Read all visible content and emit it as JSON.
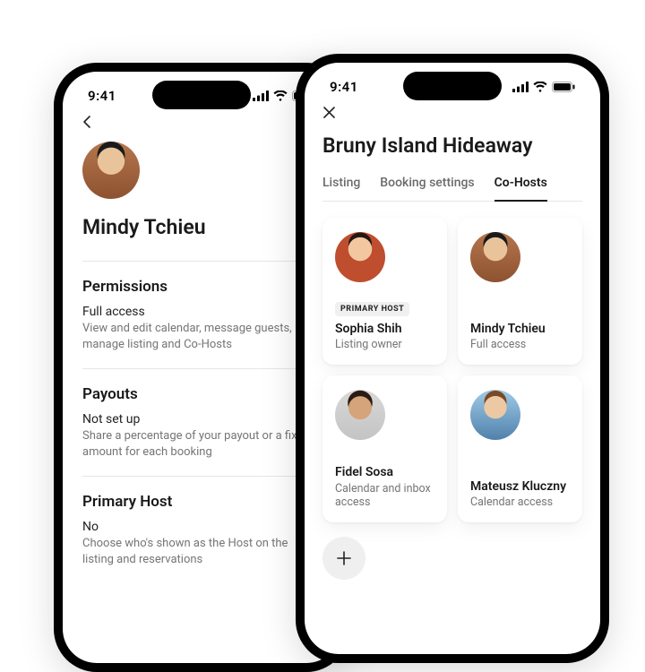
{
  "status": {
    "time": "9:41"
  },
  "back": {
    "name": "Mindy Tchieu",
    "sections": [
      {
        "title": "Permissions",
        "value": "Full access",
        "desc": "View and edit calendar, message guests, manage listing and Co-Hosts"
      },
      {
        "title": "Payouts",
        "value": "Not set up",
        "desc": "Share a percentage of your payout or a fixed amount for each booking"
      },
      {
        "title": "Primary Host",
        "value": "No",
        "desc": "Choose who's shown as the Host on the listing and reservations"
      }
    ]
  },
  "front": {
    "title": "Bruny Island Hideaway",
    "tabs": [
      {
        "label": "Listing",
        "active": false
      },
      {
        "label": "Booking settings",
        "active": false
      },
      {
        "label": "Co-Hosts",
        "active": true
      }
    ],
    "hosts": [
      {
        "name": "Sophia Shih",
        "role": "Listing owner",
        "badge": "PRIMARY HOST",
        "face": "f1"
      },
      {
        "name": "Mindy Tchieu",
        "role": "Full access",
        "badge": null,
        "face": "f2"
      },
      {
        "name": "Fidel Sosa",
        "role": "Calendar and inbox access",
        "badge": null,
        "face": "f3"
      },
      {
        "name": "Mateusz Kluczny",
        "role": "Calendar access",
        "badge": null,
        "face": "f4"
      }
    ]
  }
}
